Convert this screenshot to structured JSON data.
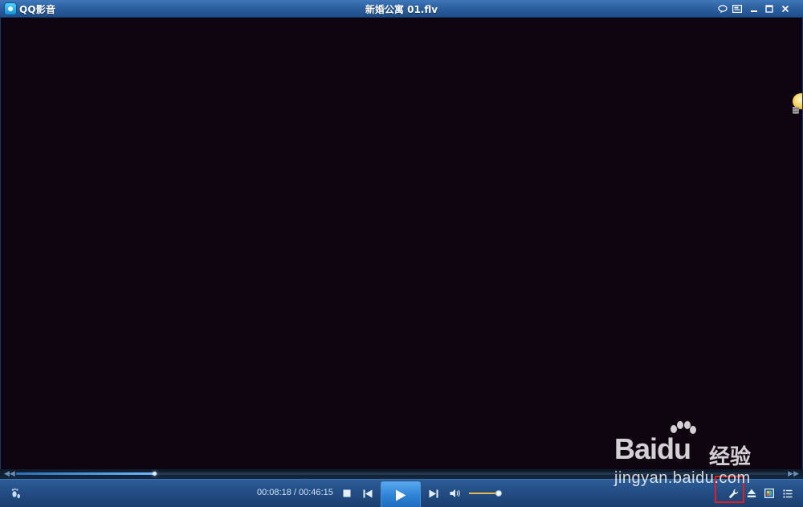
{
  "titlebar": {
    "app_name": "QQ影音",
    "file_name": "新婚公寓 01.flv"
  },
  "player": {
    "current_time": "00:08:18",
    "total_time": "00:46:15",
    "time_separator": " / ",
    "progress": 0.18,
    "volume": 0.93
  },
  "watermark": {
    "logo": "Baidu",
    "product": "经验",
    "url": "jingyan.baidu.com"
  },
  "icons": {
    "app": "qq-player-logo-icon",
    "skin": "speech-bubble-icon",
    "mini": "mini-mode-icon",
    "minimize": "minimize-icon",
    "maximize": "maximize-icon",
    "close": "close-icon",
    "footprint": "footprint-icon",
    "stop": "stop-icon",
    "previous": "previous-icon",
    "play": "play-icon",
    "next": "next-icon",
    "volume": "speaker-icon",
    "tools": "wrench-icon",
    "eject": "eject-icon",
    "screenshot": "picture-icon",
    "playlist": "playlist-icon",
    "hint": "lightbulb-icon"
  },
  "colors": {
    "highlight": "#e02020",
    "accent": "#2f84d6"
  }
}
